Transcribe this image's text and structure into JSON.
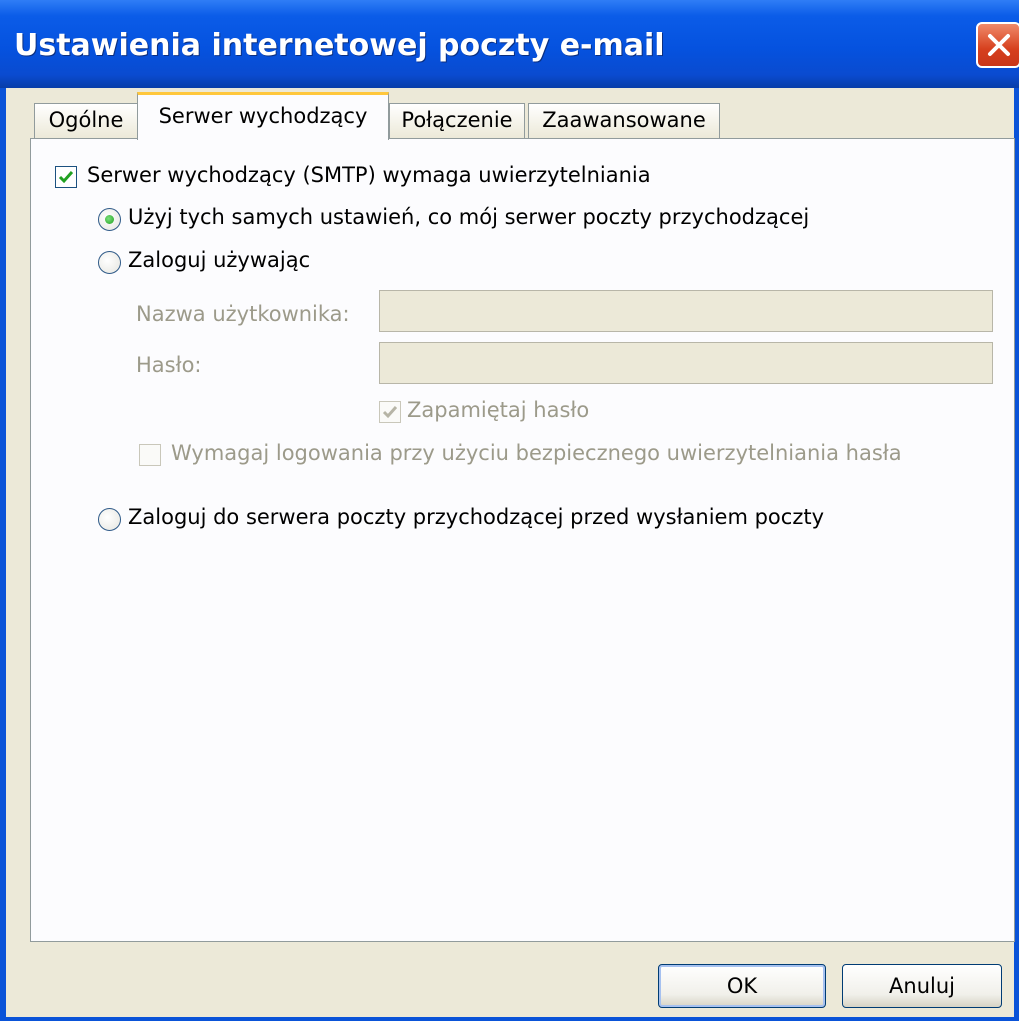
{
  "window": {
    "title": "Ustawienia internetowej poczty e-mail"
  },
  "tabs": [
    {
      "label": "Ogólne",
      "active": false
    },
    {
      "label": "Serwer wychodzący",
      "active": true
    },
    {
      "label": "Połączenie",
      "active": false
    },
    {
      "label": "Zaawansowane",
      "active": false
    }
  ],
  "smtp_auth": {
    "label": "Serwer wychodzący (SMTP) wymaga uwierzytelniania",
    "checked": true
  },
  "options": {
    "same_settings": {
      "label": "Użyj tych samych ustawień, co mój serwer poczty przychodzącej",
      "selected": true
    },
    "log_on_using": {
      "label": "Zaloguj używając",
      "selected": false
    },
    "log_on_before_send": {
      "label": "Zaloguj do serwera poczty przychodzącej przed wysłaniem poczty",
      "selected": false
    }
  },
  "credentials": {
    "username_label": "Nazwa użytkownika:",
    "username_value": "",
    "password_label": "Hasło:",
    "password_value": "",
    "remember_password": {
      "label": "Zapamiętaj hasło",
      "checked": true,
      "enabled": false
    },
    "require_spa": {
      "label": "Wymagaj logowania przy użyciu bezpiecznego uwierzytelniania hasła",
      "checked": false,
      "enabled": false
    }
  },
  "buttons": {
    "ok": "OK",
    "cancel": "Anuluj"
  },
  "colors": {
    "titlebar": "#0552df",
    "accent_tab": "#ffc73c",
    "close_button": "#d6401e",
    "check": "#21a121"
  }
}
